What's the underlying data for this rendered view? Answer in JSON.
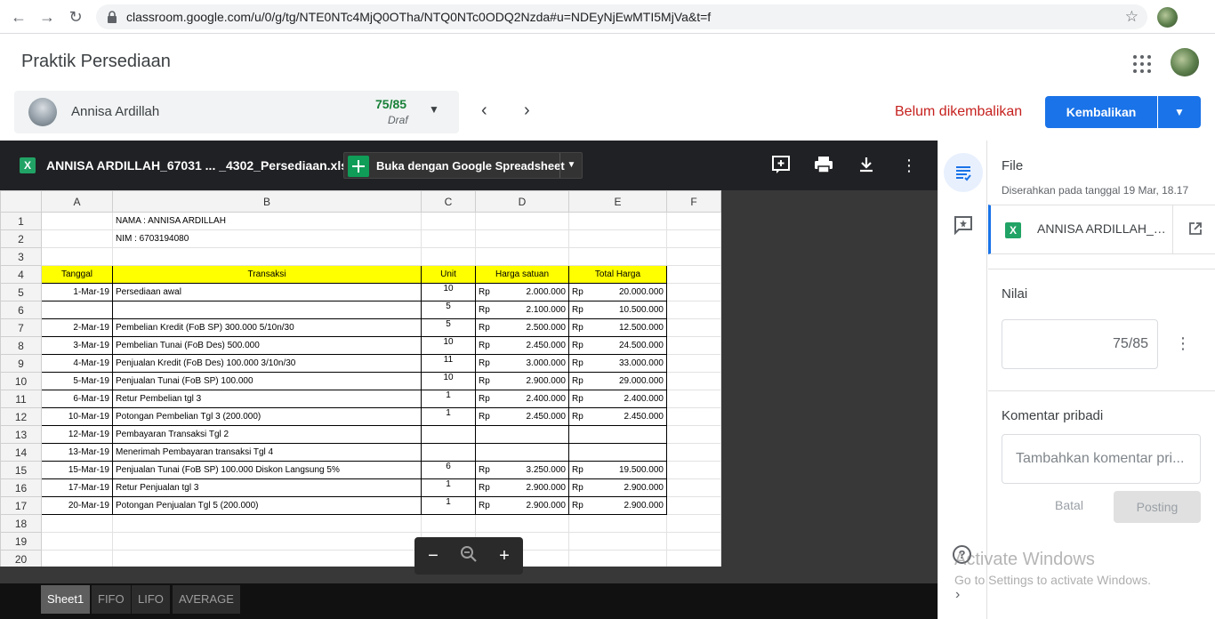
{
  "browser": {
    "url": "classroom.google.com/u/0/g/tg/NTE0NTc4MjQ0OTha/NTQ0NTc0ODQ2Nzda#u=NDEyNjEwMTI5MjVa&t=f",
    "back_icon": "arrow-left",
    "forward_icon": "arrow-right",
    "reload_icon": "reload",
    "star_icon": "star"
  },
  "header": {
    "title": "Praktik Persediaan"
  },
  "student": {
    "name": "Annisa Ardillah",
    "grade": "75/85",
    "status": "Draf"
  },
  "actions": {
    "status_text": "Belum dikembalikan",
    "return_label": "Kembalikan"
  },
  "viewer": {
    "filename": "ANNISA ARDILLAH_67031 ... _4302_Persediaan.xlsx",
    "open_with_label": "Buka dengan Google Spreadsheet"
  },
  "sheet": {
    "col_headers": [
      "A",
      "B",
      "C",
      "D",
      "E",
      "F"
    ],
    "row_numbers": [
      "1",
      "2",
      "3",
      "4",
      "5",
      "6",
      "7",
      "8",
      "9",
      "10",
      "11",
      "12",
      "13",
      "14",
      "15",
      "16",
      "17",
      "18",
      "19",
      "20"
    ],
    "name_line": "NAMA : ANNISA ARDILLAH",
    "nim_line": "NIM    : 6703194080",
    "table_headers": [
      "Tanggal",
      "Transaksi",
      "Unit",
      "Harga satuan",
      "Total Harga"
    ],
    "currency": "Rp",
    "rows": [
      {
        "date": "1-Mar-19",
        "desc": "Persediaan awal",
        "unit": "10",
        "price": "2.000.000",
        "total": "20.000.000"
      },
      {
        "date": "",
        "desc": "",
        "unit": "5",
        "price": "2.100.000",
        "total": "10.500.000"
      },
      {
        "date": "2-Mar-19",
        "desc": "Pembelian Kredit (FoB SP) 300.000 5/10n/30",
        "unit": "5",
        "price": "2.500.000",
        "total": "12.500.000"
      },
      {
        "date": "3-Mar-19",
        "desc": "Pembelian Tunai (FoB Des) 500.000",
        "unit": "10",
        "price": "2.450.000",
        "total": "24.500.000"
      },
      {
        "date": "4-Mar-19",
        "desc": "Penjualan Kredit (FoB Des) 100.000 3/10n/30",
        "unit": "11",
        "price": "3.000.000",
        "total": "33.000.000"
      },
      {
        "date": "5-Mar-19",
        "desc": "Penjualan Tunai (FoB SP) 100.000",
        "unit": "10",
        "price": "2.900.000",
        "total": "29.000.000"
      },
      {
        "date": "6-Mar-19",
        "desc": "Retur Pembelian tgl 3",
        "unit": "1",
        "price": "2.400.000",
        "total": "2.400.000"
      },
      {
        "date": "10-Mar-19",
        "desc": "Potongan Pembelian Tgl 3 (200.000)",
        "unit": "1",
        "price": "2.450.000",
        "total": "2.450.000"
      },
      {
        "date": "12-Mar-19",
        "desc": "Pembayaran  Transaksi Tgl 2",
        "unit": "",
        "price": "",
        "total": ""
      },
      {
        "date": "13-Mar-19",
        "desc": "Menerimah Pembayaran transaksi Tgl 4",
        "unit": "",
        "price": "",
        "total": ""
      },
      {
        "date": "15-Mar-19",
        "desc": "Penjualan Tunai (FoB SP) 100.000 Diskon Langsung 5%",
        "unit": "6",
        "price": "3.250.000",
        "total": "19.500.000"
      },
      {
        "date": "17-Mar-19",
        "desc": "Retur Penjualan tgl 3",
        "unit": "1",
        "price": "2.900.000",
        "total": "2.900.000"
      },
      {
        "date": "20-Mar-19",
        "desc": "Potongan Penjualan Tgl 5 (200.000)",
        "unit": "1",
        "price": "2.900.000",
        "total": "2.900.000"
      }
    ],
    "tabs": [
      "Sheet1",
      "FIFO",
      "LIFO",
      "AVERAGE"
    ],
    "active_tab": "Sheet1"
  },
  "panel": {
    "file_title": "File",
    "submitted": "Diserahkan pada tanggal 19 Mar, 18.17",
    "file_name": "ANNISA ARDILLAH_6...",
    "grade_title": "Nilai",
    "grade_value": "75/85",
    "comment_title": "Komentar pribadi",
    "comment_placeholder": "Tambahkan komentar pri...",
    "cancel_label": "Batal",
    "post_label": "Posting"
  },
  "watermark": {
    "line1": "Activate Windows",
    "line2": "Go to Settings to activate Windows."
  },
  "colors": {
    "accent": "#1a73e8",
    "grade_green": "#188038",
    "status_red": "#c5221f",
    "header_yellow": "#ffff00"
  }
}
